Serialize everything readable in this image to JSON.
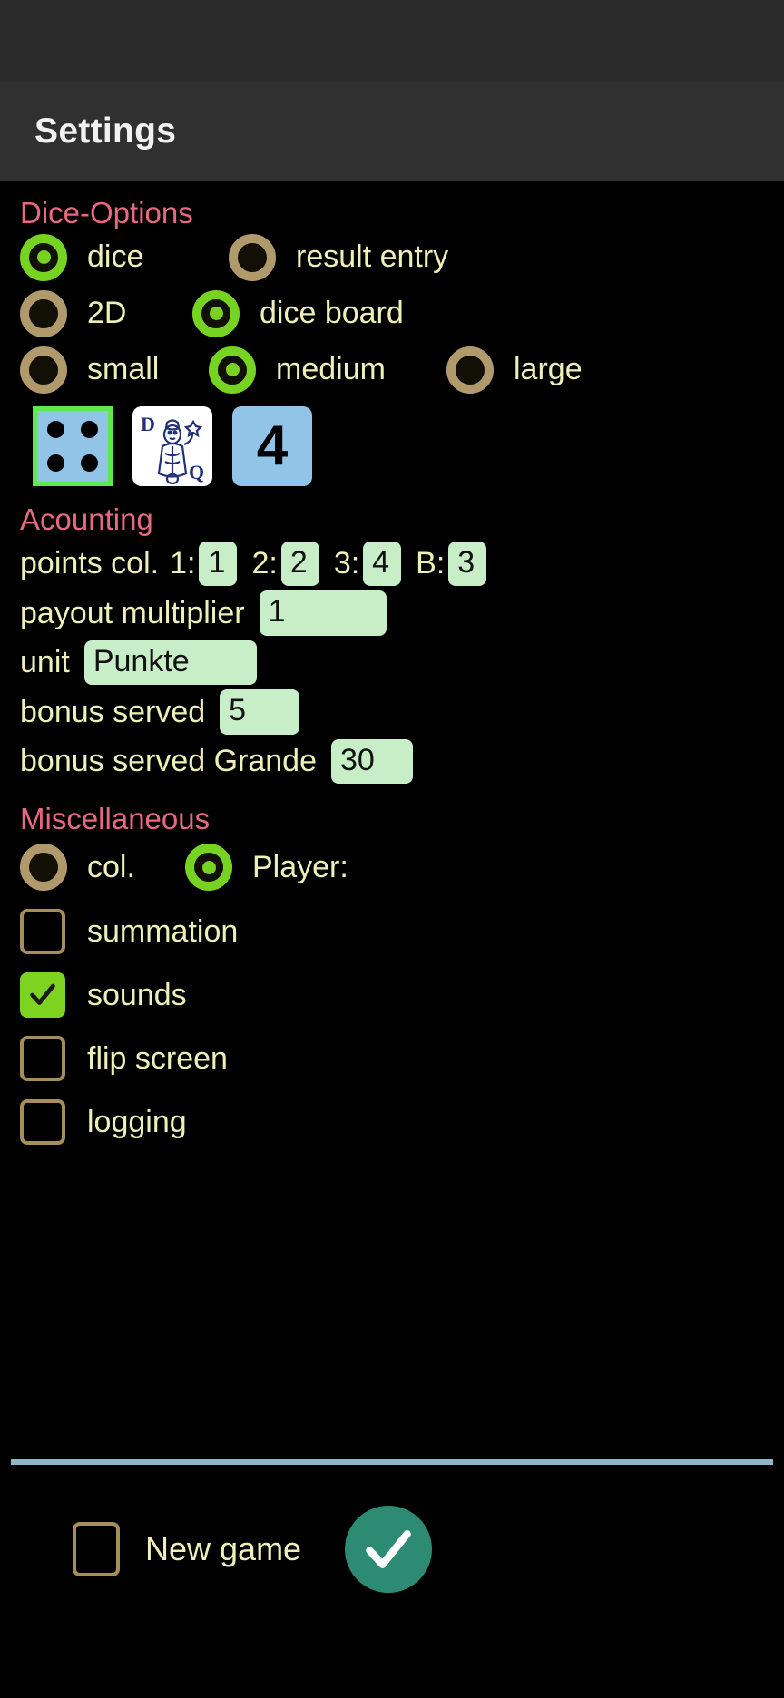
{
  "app": {
    "title": "Settings"
  },
  "dice_options": {
    "title": "Dice-Options",
    "row1": [
      {
        "label": "dice",
        "selected": true,
        "icon": "radio-selected-icon"
      },
      {
        "label": "result entry",
        "selected": false,
        "icon": "radio-unselected-icon"
      }
    ],
    "row2": [
      {
        "label": "2D",
        "selected": false,
        "icon": "radio-unselected-icon"
      },
      {
        "label": "dice board",
        "selected": true,
        "icon": "radio-selected-icon"
      }
    ],
    "row3": [
      {
        "label": "small",
        "selected": false,
        "icon": "radio-unselected-icon"
      },
      {
        "label": "medium",
        "selected": true,
        "icon": "radio-selected-icon"
      },
      {
        "label": "large",
        "selected": false,
        "icon": "radio-unselected-icon"
      }
    ],
    "thumbnails": [
      {
        "name": "dice-face-thumbnail",
        "kind": "dice",
        "pips": 4,
        "selected": true
      },
      {
        "name": "playing-card-thumbnail",
        "kind": "card",
        "rank_left": "D",
        "rank_right": "Q",
        "selected": false
      },
      {
        "name": "number-face-thumbnail",
        "kind": "number",
        "value": "4",
        "selected": false
      }
    ]
  },
  "accounting": {
    "title": "Acounting",
    "points": {
      "label": "points col.",
      "col1_label": "1:",
      "col1_value": "1",
      "col2_label": "2:",
      "col2_value": "2",
      "col3_label": "3:",
      "col3_value": "4",
      "bonus_label": "B:",
      "bonus_value": "3"
    },
    "payout_multiplier": {
      "label": "payout multiplier",
      "value": "1"
    },
    "unit": {
      "label": "unit",
      "value": "Punkte"
    },
    "bonus_served": {
      "label": "bonus served",
      "value": "5"
    },
    "bonus_served_grande": {
      "label": "bonus served Grande",
      "value": "30"
    }
  },
  "miscellaneous": {
    "title": "Miscellaneous",
    "mode": [
      {
        "label": "col.",
        "selected": false,
        "icon": "radio-unselected-icon"
      },
      {
        "label": "Player:",
        "selected": true,
        "icon": "radio-selected-icon"
      }
    ],
    "checkboxes": [
      {
        "label": "summation",
        "checked": false,
        "icon": "checkbox-unchecked-icon"
      },
      {
        "label": "sounds",
        "checked": true,
        "icon": "checkbox-checked-icon"
      },
      {
        "label": "flip screen",
        "checked": false,
        "icon": "checkbox-unchecked-icon"
      },
      {
        "label": "logging",
        "checked": false,
        "icon": "checkbox-unchecked-icon"
      }
    ]
  },
  "bottom": {
    "new_game_label": "New game",
    "new_game_checked": false,
    "confirm_icon": "checkmark-icon"
  },
  "colors": {
    "background": "#000000",
    "app_bar": "#303030",
    "status_bar": "#2b2b2b",
    "section_heading": "#e8697f",
    "label_text": "#eff0b8",
    "accent_green": "#77d321",
    "radio_off_ring": "#b09a6c",
    "field_bg": "#c8eec8",
    "confirm_green": "#2e8b73",
    "divider": "#8fb7c9",
    "dice_blue": "#92c4e8",
    "card_navy": "#22307a"
  }
}
